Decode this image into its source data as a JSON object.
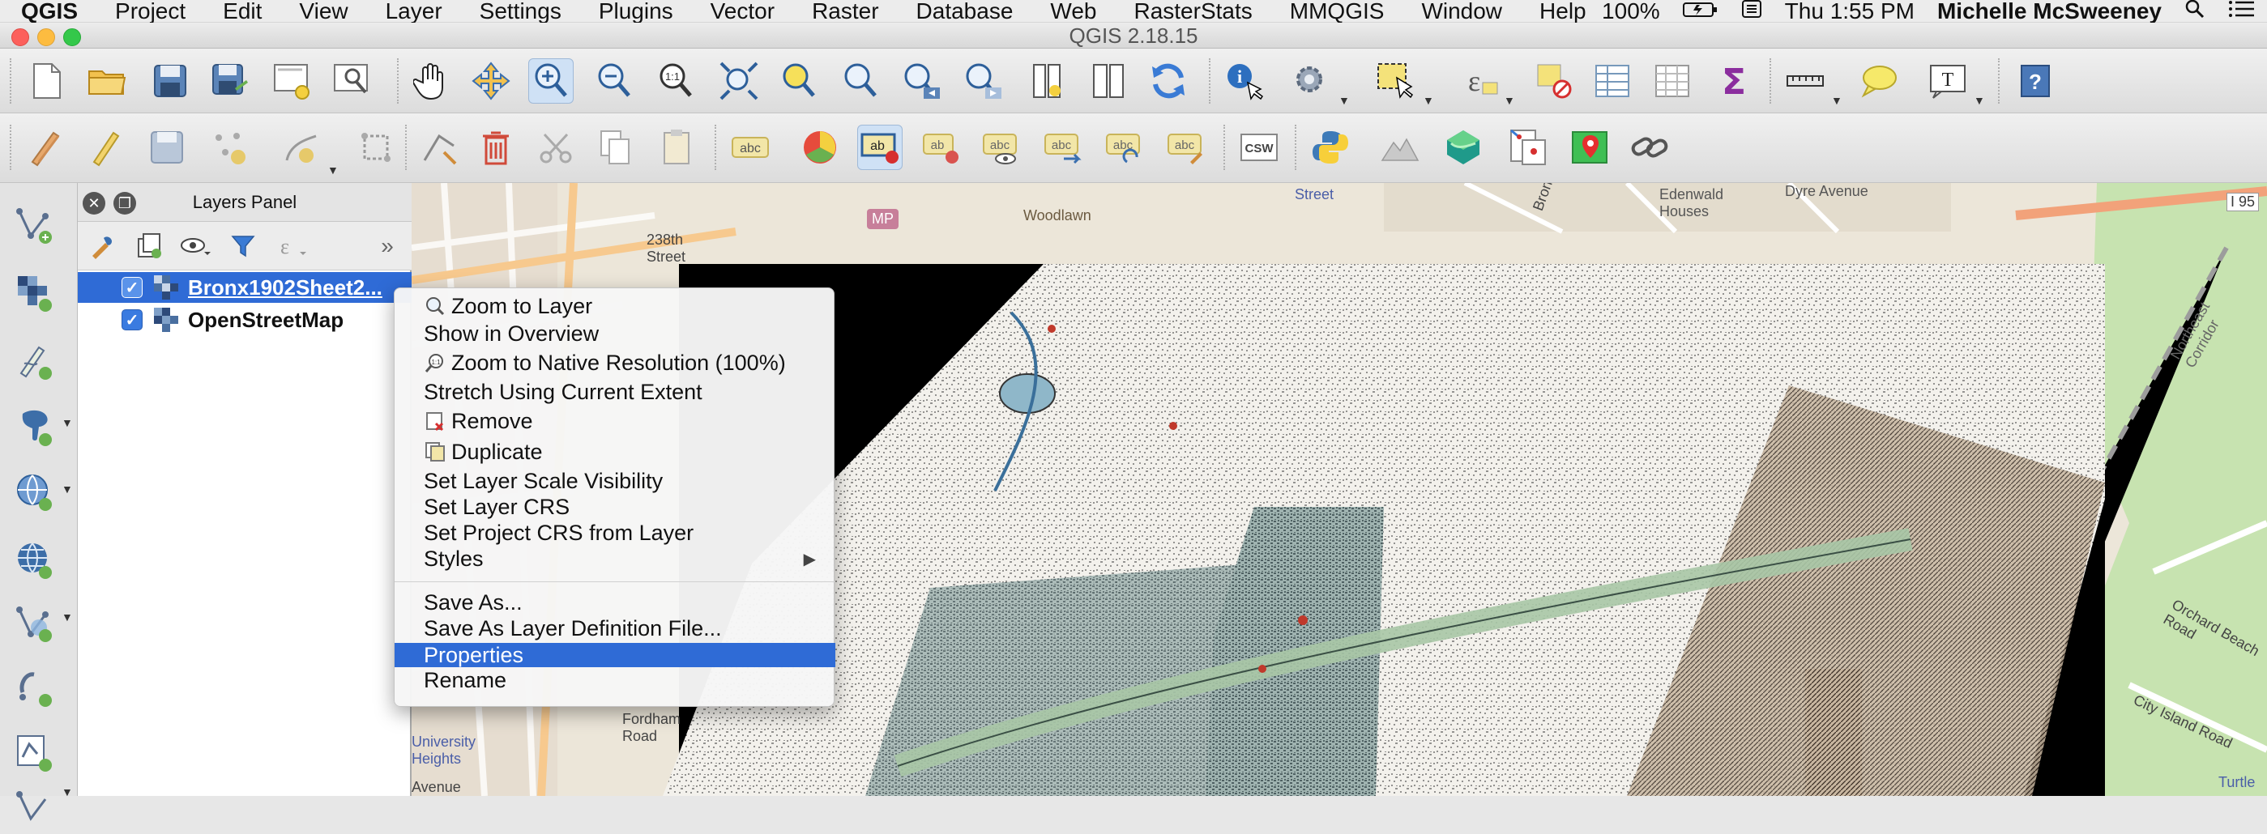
{
  "menubar": {
    "app": "QGIS",
    "items": [
      "Project",
      "Edit",
      "View",
      "Layer",
      "Settings",
      "Plugins",
      "Vector",
      "Raster",
      "Database",
      "Web",
      "RasterStats",
      "MMQGIS",
      "Window",
      "Help"
    ],
    "battery": "100%",
    "clock": "Thu 1:55 PM",
    "user": "Michelle McSweeney"
  },
  "window": {
    "title": "QGIS 2.18.15"
  },
  "layers_panel": {
    "title": "Layers Panel",
    "layers": [
      {
        "name": "Bronx1902Sheet2...",
        "checked": true,
        "selected": true
      },
      {
        "name": "OpenStreetMap",
        "checked": true,
        "selected": false
      }
    ]
  },
  "context_menu": {
    "items": [
      {
        "label": "Zoom to Layer",
        "icon": "zoom-layer-icon"
      },
      {
        "label": "Show in Overview"
      },
      {
        "label": "Zoom to Native Resolution (100%)",
        "icon": "zoom-native-icon"
      },
      {
        "label": "Stretch Using Current Extent"
      },
      {
        "label": "Remove",
        "icon": "remove-icon"
      },
      {
        "label": "Duplicate",
        "icon": "duplicate-icon"
      },
      {
        "label": "Set Layer Scale Visibility"
      },
      {
        "label": "Set Layer CRS"
      },
      {
        "label": "Set Project CRS from Layer"
      },
      {
        "label": "Styles",
        "submenu": true
      },
      {
        "label": "Save As..."
      },
      {
        "label": "Save As Layer Definition File..."
      },
      {
        "label": "Properties",
        "highlighted": true
      },
      {
        "label": "Rename"
      }
    ]
  },
  "map_labels": {
    "woodlawn": "Woodlawn",
    "dyre": "Dyre Avenue",
    "i95": "I 95",
    "mp": "MP",
    "university_heights": "University Heights",
    "fordham": "Fordham Road",
    "turtle": "Turtle",
    "city_island": "City Island Road",
    "orchard": "Orchard Beach Road",
    "northeast_corridor": "Northeast Corridor",
    "bronx_pkwy": "Bronx River Parkway",
    "edenwald": "Edenwald Houses",
    "street": "Street",
    "street_238": "238th Street",
    "avenue": "Avenue"
  },
  "colors": {
    "highlight": "#2f6bd6",
    "map_base": "#ece6d9",
    "park": "#c7e3b0",
    "overlay_black": "#000000"
  }
}
